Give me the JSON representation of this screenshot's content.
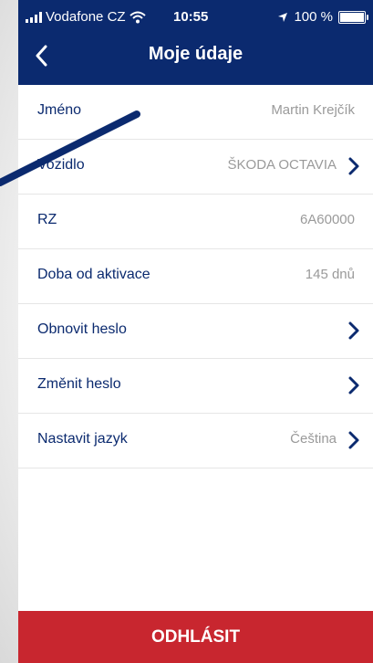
{
  "status_bar": {
    "carrier": "Vodafone CZ",
    "time": "10:55",
    "battery": "100 %"
  },
  "header": {
    "title": "Moje údaje",
    "back_icon": "chevron-left-icon"
  },
  "rows": [
    {
      "label": "Jméno",
      "value": "Martin Krejčík",
      "chevron": false
    },
    {
      "label": "Vozidlo",
      "value": "ŠKODA OCTAVIA",
      "chevron": true
    },
    {
      "label": "RZ",
      "value": "6A60000",
      "chevron": false
    },
    {
      "label": "Doba od aktivace",
      "value": "145 dnů",
      "chevron": false
    },
    {
      "label": "Obnovit heslo",
      "value": "",
      "chevron": true
    },
    {
      "label": "Změnit heslo",
      "value": "",
      "chevron": true
    },
    {
      "label": "Nastavit jazyk",
      "value": "Čeština",
      "chevron": true
    }
  ],
  "logout_label": "ODHLÁSIT",
  "colors": {
    "header": "#0b2a6f",
    "accent": "#0b2a6f",
    "logout": "#c8262f",
    "value_text": "#9a9a9a"
  }
}
